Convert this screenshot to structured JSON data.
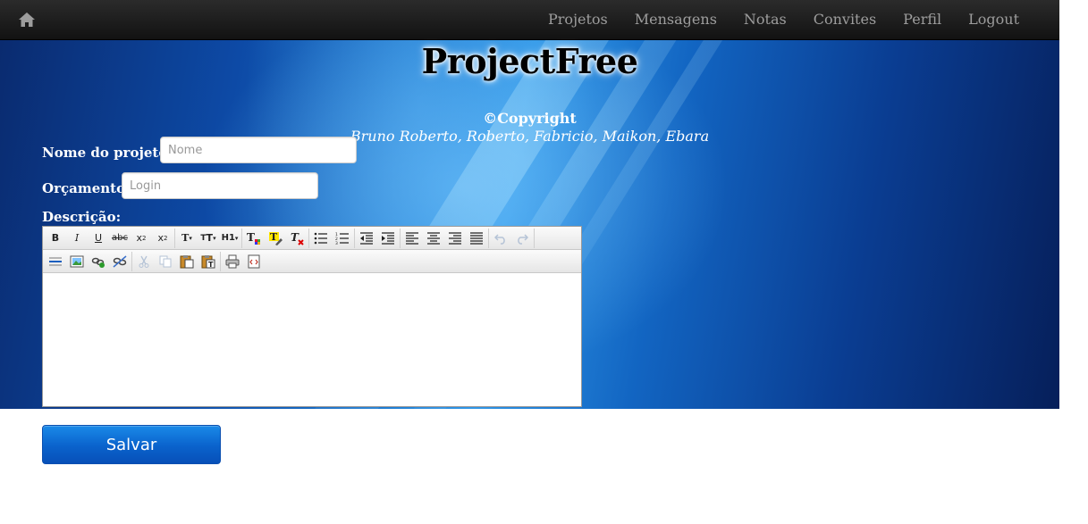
{
  "navbar": {
    "home_icon": "home-icon",
    "links": [
      "Projetos",
      "Mensagens",
      "Notas",
      "Convites",
      "Perfil",
      "Logout"
    ]
  },
  "header": {
    "title": "ProjectFree",
    "copyright": "©Copyright",
    "authors": "Bruno Roberto, Roberto, Fabricio, Maikon, Ebara"
  },
  "form": {
    "project_name_label": "Nome do projeto:",
    "project_name_placeholder": "Nome",
    "budget_label": "Orçamento:",
    "budget_placeholder": "Login",
    "description_label": "Descrição:",
    "editor_toolbar_row1": [
      "bold",
      "italic",
      "underline",
      "strikethrough",
      "subscript",
      "superscript",
      "font-family",
      "font-size",
      "heading",
      "text-color",
      "background-color",
      "remove-format",
      "bulleted-list",
      "numbered-list",
      "outdent",
      "indent",
      "align-left",
      "align-center",
      "align-right",
      "justify",
      "undo",
      "redo"
    ],
    "editor_toolbar_row2": [
      "horizontal-rule",
      "image",
      "link",
      "unlink",
      "cut",
      "copy",
      "paste",
      "paste-text",
      "print",
      "source"
    ],
    "save_label": "Salvar"
  },
  "colors": {
    "navbar": "#1b1b1b",
    "nav_text": "#9d9d9d",
    "hero_blue": "#1265c2",
    "button_blue": "#0a62cc"
  }
}
